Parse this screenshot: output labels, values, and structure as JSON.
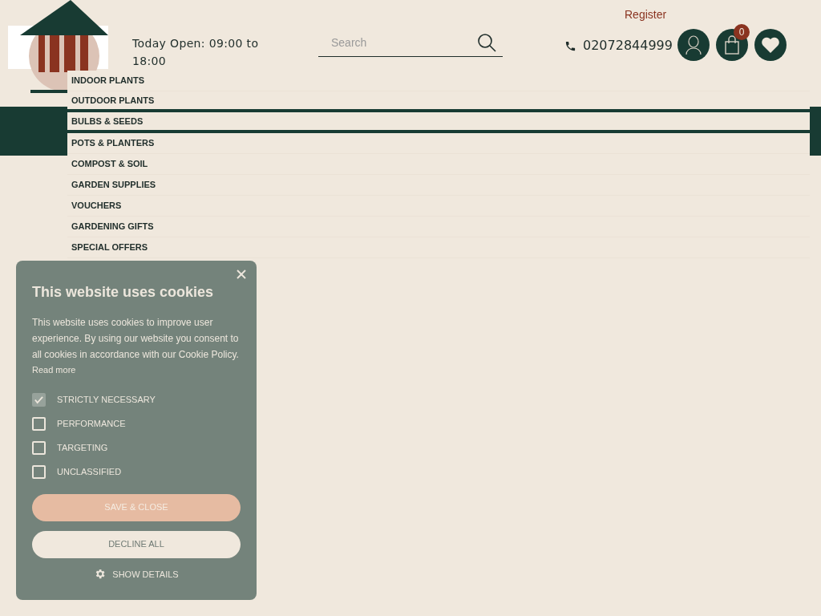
{
  "header": {
    "opening_hours": "Today Open: 09:00 to 18:00",
    "search": {
      "placeholder": "Search"
    },
    "phone": "02072844999",
    "register_link": "Register",
    "basket_count": "0"
  },
  "menu": [
    {
      "label": "INDOOR PLANTS"
    },
    {
      "label": "OUTDOOR PLANTS"
    },
    {
      "label": "BULBS & SEEDS"
    },
    {
      "label": "POTS & PLANTERS"
    },
    {
      "label": "COMPOST & SOIL"
    },
    {
      "label": "GARDEN SUPPLIES"
    },
    {
      "label": "VOUCHERS"
    },
    {
      "label": "GARDENING GIFTS"
    },
    {
      "label": "SPECIAL OFFERS"
    }
  ],
  "cookie_dialog": {
    "title": "This website uses cookies",
    "body": "This website uses cookies to improve user experience. By using our website you consent to all cookies in accordance with our Cookie Policy.",
    "read_more": "Read more",
    "options": [
      {
        "label": "STRICTLY NECESSARY",
        "checked": true,
        "disabled": true
      },
      {
        "label": "PERFORMANCE",
        "checked": false,
        "disabled": false
      },
      {
        "label": "TARGETING",
        "checked": false,
        "disabled": false
      },
      {
        "label": "UNCLASSIFIED",
        "checked": false,
        "disabled": false
      }
    ],
    "buttons": [
      {
        "label": "SAVE & CLOSE",
        "kind": "primary"
      },
      {
        "label": "DECLINE ALL",
        "kind": "secondary"
      }
    ],
    "show_details": "SHOW DETAILS"
  }
}
